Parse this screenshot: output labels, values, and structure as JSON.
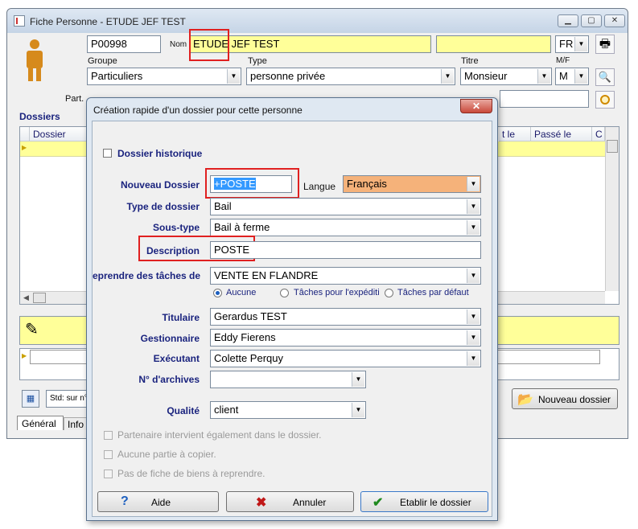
{
  "main_window": {
    "title": "Fiche Personne - ETUDE JEF TEST",
    "code": "P00998",
    "nom_label": "Nom",
    "nom_value": "ETUDE JEF TEST",
    "lang_code": "FR",
    "labels": {
      "groupe": "Groupe",
      "type": "Type",
      "titre": "Titre",
      "mf": "M/F",
      "part": "Part."
    },
    "groupe_value": "Particuliers",
    "type_value": "personne privée",
    "titre_value": "Monsieur",
    "mf_value": "M",
    "dossiers_label": "Dossiers",
    "columns": [
      "Dossier",
      "t le",
      "Passé le",
      "C"
    ],
    "std_text": "Std: sur n°",
    "nouveau_dossier_label": "Nouveau dossier",
    "tabs": [
      "Général",
      "Info"
    ]
  },
  "dialog": {
    "title": "Création rapide d'un dossier pour cette personne",
    "historique_label": "Dossier historique",
    "labels": {
      "nouveau_dossier": "Nouveau Dossier",
      "langue": "Langue",
      "type_dossier": "Type de dossier",
      "sous_type": "Sous-type",
      "description": "Description",
      "reprendre": "eprendre des tâches de",
      "titulaire": "Titulaire",
      "gestionnaire": "Gestionnaire",
      "executant": "Exécutant",
      "archives": "N° d'archives",
      "qualite": "Qualité"
    },
    "values": {
      "nouveau_dossier": "+POSTE",
      "langue": "Français",
      "type_dossier": "Bail",
      "sous_type": "Bail à ferme",
      "description": "POSTE",
      "reprendre": "VENTE EN FLANDRE",
      "titulaire": "Gerardus TEST",
      "gestionnaire": "Eddy Fierens",
      "executant": "Colette Perquy",
      "archives": "",
      "qualite": "client"
    },
    "radios": [
      "Aucune",
      "Tâches pour l'expéditi",
      "Tâches par défaut"
    ],
    "disabled_checks": [
      "Partenaire intervient également dans le dossier.",
      "Aucune partie à copier.",
      "Pas de fiche de biens à reprendre."
    ],
    "buttons": {
      "aide": "Aide",
      "annuler": "Annuler",
      "etablir": "Etablir le dossier"
    }
  },
  "colors": {
    "highlight_field": "#ffff99",
    "langue_field": "#f5b27a",
    "annotation_box": "#e02020"
  }
}
